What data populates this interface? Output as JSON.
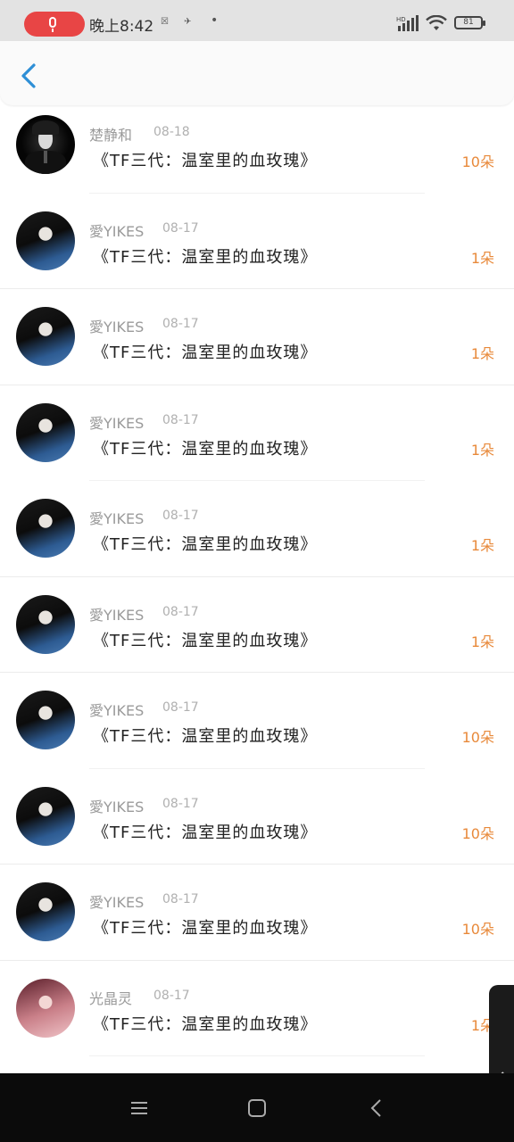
{
  "status_bar": {
    "time": "晚上8:42",
    "notif_1": "☒",
    "notif_2": "✈",
    "dot": "•",
    "battery_level": "81",
    "network_label": "HD",
    "mic_color": "#e84545"
  },
  "header": {
    "back_icon": "chevron-left-icon",
    "accent_color": "#2e8fd6"
  },
  "rows": [
    {
      "name": "楚静和",
      "date": "08-18",
      "title": "《TF三代：温室里的血玫瑰》",
      "count": "10朵",
      "avatar": "dark"
    },
    {
      "name": "愛YIKES",
      "date": "08-17",
      "title": "《TF三代：温室里的血玫瑰》",
      "count": "1朵",
      "avatar": "girl"
    },
    {
      "name": "愛YIKES",
      "date": "08-17",
      "title": "《TF三代：温室里的血玫瑰》",
      "count": "1朵",
      "avatar": "girl"
    },
    {
      "name": "愛YIKES",
      "date": "08-17",
      "title": "《TF三代：温室里的血玫瑰》",
      "count": "1朵",
      "avatar": "girl"
    },
    {
      "name": "愛YIKES",
      "date": "08-17",
      "title": "《TF三代：温室里的血玫瑰》",
      "count": "1朵",
      "avatar": "girl"
    },
    {
      "name": "愛YIKES",
      "date": "08-17",
      "title": "《TF三代：温室里的血玫瑰》",
      "count": "1朵",
      "avatar": "girl"
    },
    {
      "name": "愛YIKES",
      "date": "08-17",
      "title": "《TF三代：温室里的血玫瑰》",
      "count": "10朵",
      "avatar": "girl"
    },
    {
      "name": "愛YIKES",
      "date": "08-17",
      "title": "《TF三代：温室里的血玫瑰》",
      "count": "10朵",
      "avatar": "girl"
    },
    {
      "name": "愛YIKES",
      "date": "08-17",
      "title": "《TF三代：温室里的血玫瑰》",
      "count": "10朵",
      "avatar": "girl"
    },
    {
      "name": "光晶灵",
      "date": "08-17",
      "title": "《TF三代：温室里的血玫瑰》",
      "count": "1朵",
      "avatar": "pink"
    }
  ],
  "count_color": "#e8893a",
  "nav_bar": {
    "menu_icon": "menu-icon",
    "home_icon": "home-square-icon",
    "back_icon": "back-triangle-icon",
    "side_tab_icon": "chevron-left-icon"
  }
}
